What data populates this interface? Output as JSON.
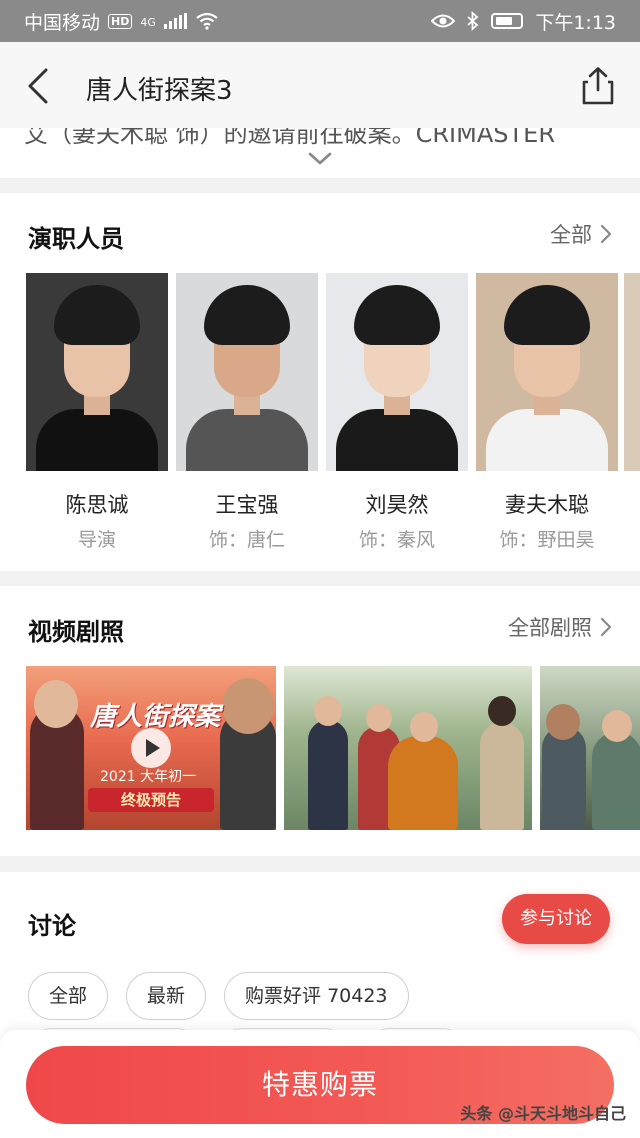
{
  "status_bar": {
    "carrier": "中国移动",
    "hd": "HD",
    "network": "4G",
    "time": "下午1:13"
  },
  "header": {
    "title": "唐人街探案3"
  },
  "synopsis": {
    "visible_tail": "艾（妻夫木聪 饰）的邀请前往破案。CRIMASTER"
  },
  "cast_section": {
    "title": "演职人员",
    "more_label": "全部",
    "members": [
      {
        "name": "陈思诚",
        "role": "导演",
        "bg": "#3a3a3a",
        "body": "#111111"
      },
      {
        "name": "王宝强",
        "role": "饰：唐仁",
        "bg": "#d9dadb",
        "body": "#555555"
      },
      {
        "name": "刘昊然",
        "role": "饰：秦风",
        "bg": "#e6e8ec",
        "body": "#1a1a1a"
      },
      {
        "name": "妻夫木聪",
        "role": "饰：野田昊",
        "bg": "#cfb9a1",
        "body": "#f2f2f2"
      }
    ]
  },
  "stills_section": {
    "title": "视频剧照",
    "more_label": "全部剧照",
    "poster": {
      "title": "唐人街探案",
      "subtitle": "2021 大年初一",
      "badge": "终极预告"
    }
  },
  "discussion": {
    "title": "讨论",
    "join_label": "参与讨论",
    "tags": [
      "全部",
      "最新",
      "购票好评 70423"
    ]
  },
  "bottom_bar": {
    "buy_label": "特惠购票"
  },
  "watermark": "头条 @斗天斗地斗自己",
  "colors": {
    "accent": "#f0484a",
    "status_bar": "#8a8a8a"
  }
}
